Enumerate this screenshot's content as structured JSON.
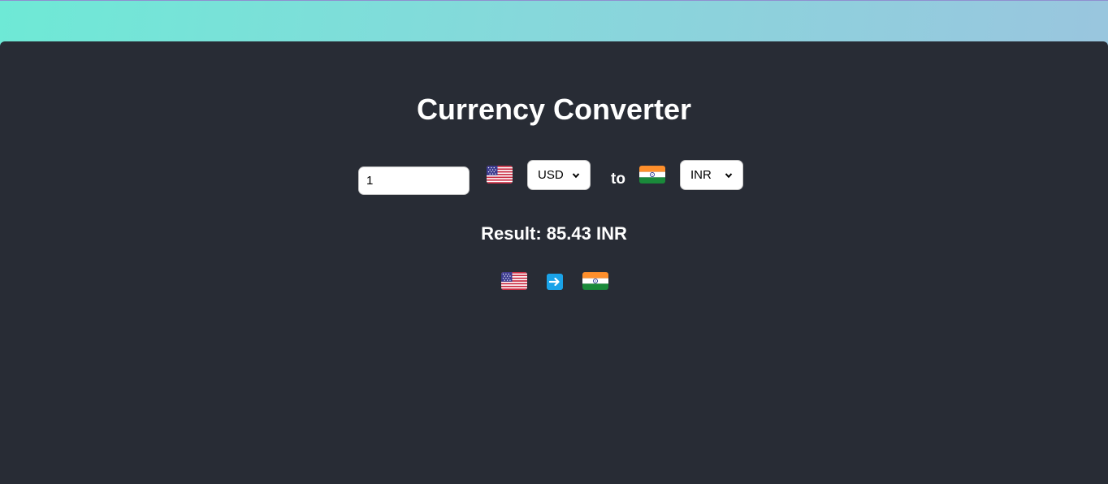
{
  "converter": {
    "title": "Currency Converter",
    "amount": "1",
    "from": {
      "currency": "USD",
      "flag_icon": "us-flag-icon"
    },
    "to_label": "to",
    "to": {
      "currency": "INR",
      "flag_icon": "india-flag-icon"
    },
    "result_text": "Result: 85.43 INR",
    "conversion_icons": [
      "us-flag-icon",
      "right-arrow-icon",
      "india-flag-icon"
    ]
  },
  "colors": {
    "background_gradient_start": "#6ee9d6",
    "background_gradient_end": "#9cc3df",
    "card_background": "#282c35",
    "text": "#ffffff",
    "arrow_badge": "#1aa3e8"
  }
}
